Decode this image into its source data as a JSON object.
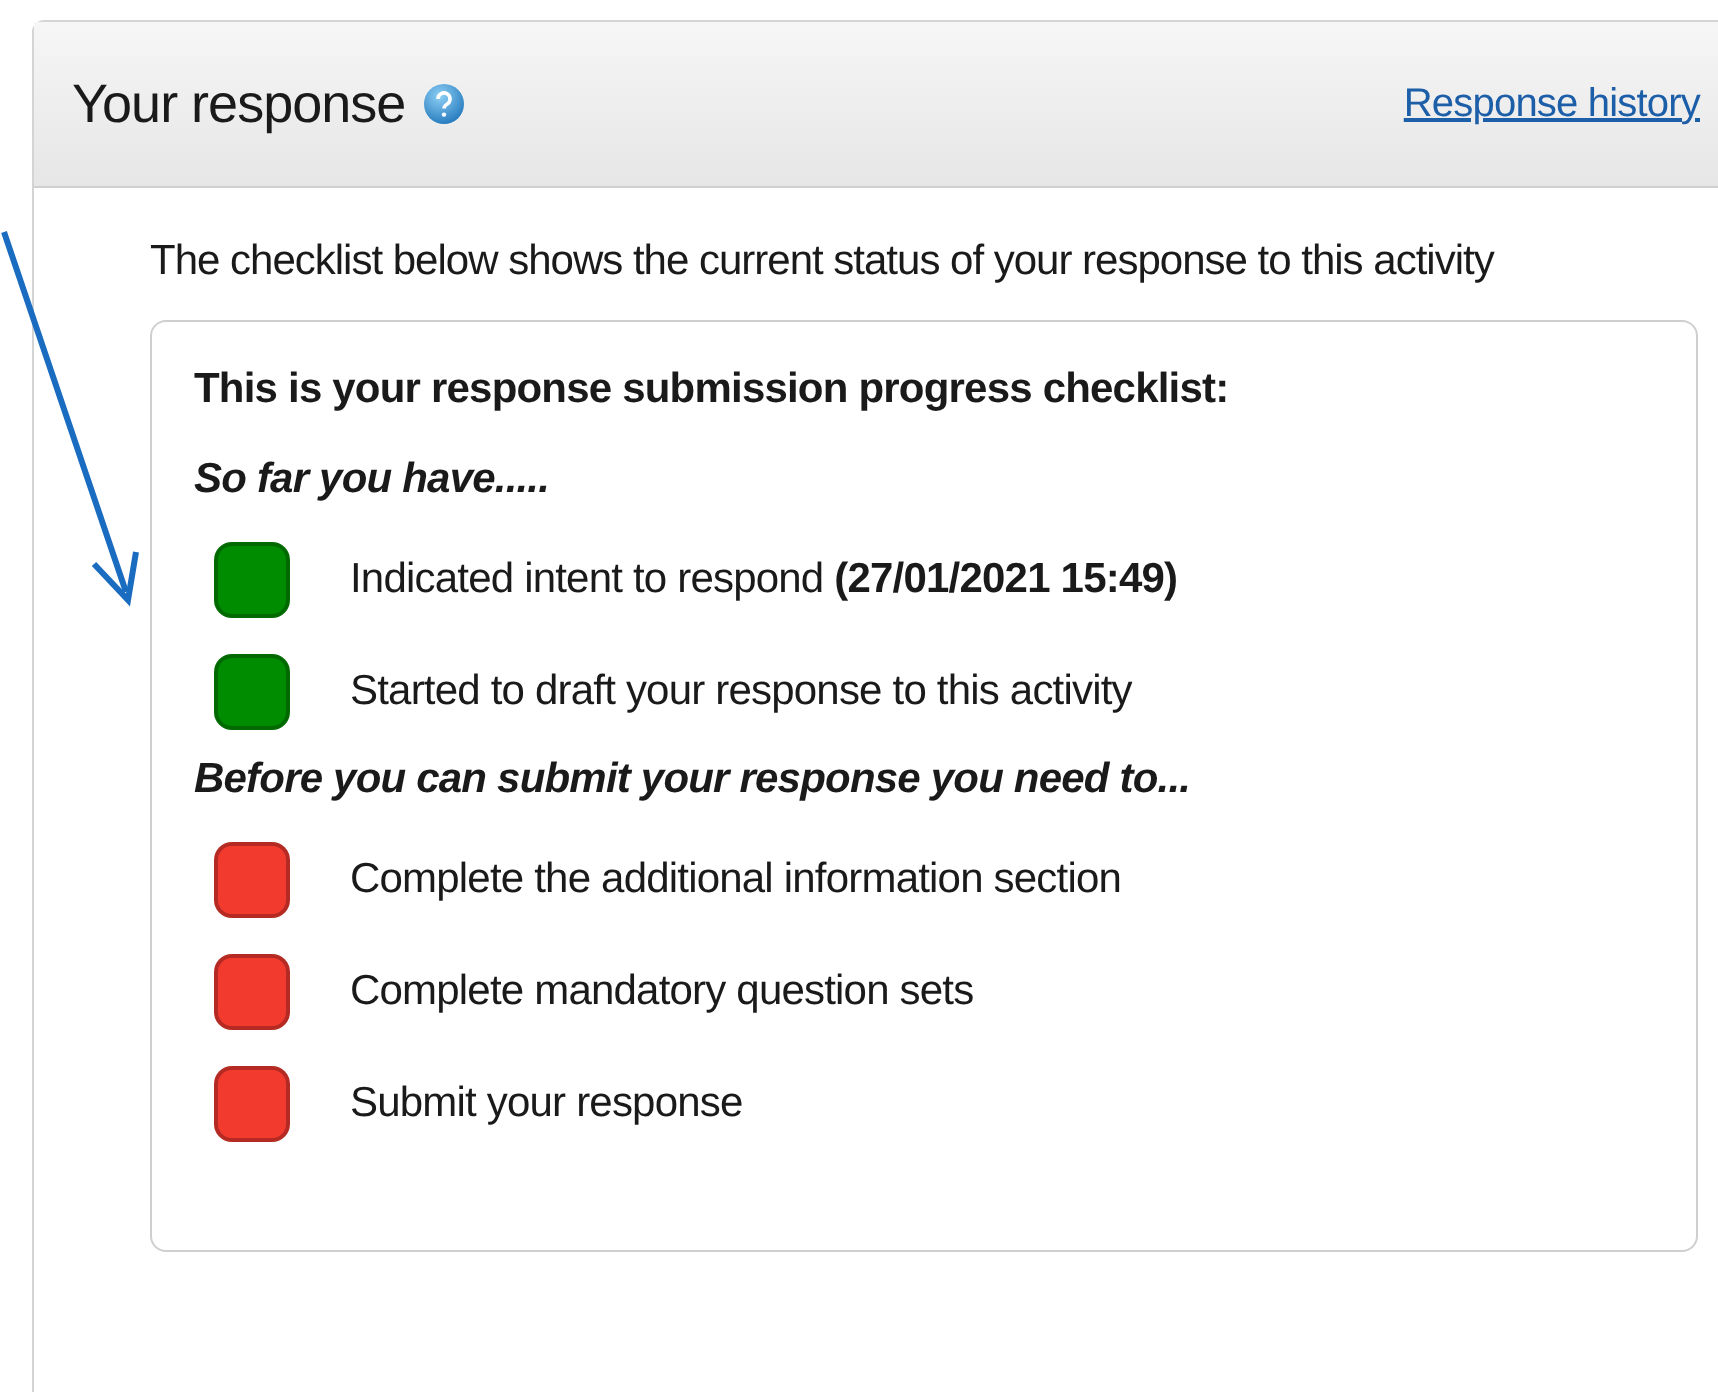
{
  "panel": {
    "title": "Your response",
    "history_link": "Response history"
  },
  "intro": "The checklist below shows the current status of your response to this activity",
  "checklist": {
    "heading": "This is your response submission progress checklist:",
    "sections": [
      {
        "heading": "So far you have.....",
        "items": [
          {
            "text": "Indicated intent to respond **(27/01/2021 15:49)**",
            "color": "#008c00"
          },
          {
            "text": "Started to draft your response to this activity",
            "color": "#008c00"
          }
        ]
      },
      {
        "heading": "Before you can submit your response you need to...",
        "items": [
          {
            "text": "Complete the additional information section",
            "color": "#f23a2f"
          },
          {
            "text": "Complete mandatory question sets",
            "color": "#f23a2f"
          },
          {
            "text": "Submit your response",
            "color": "#f23a2f"
          }
        ]
      }
    ]
  }
}
